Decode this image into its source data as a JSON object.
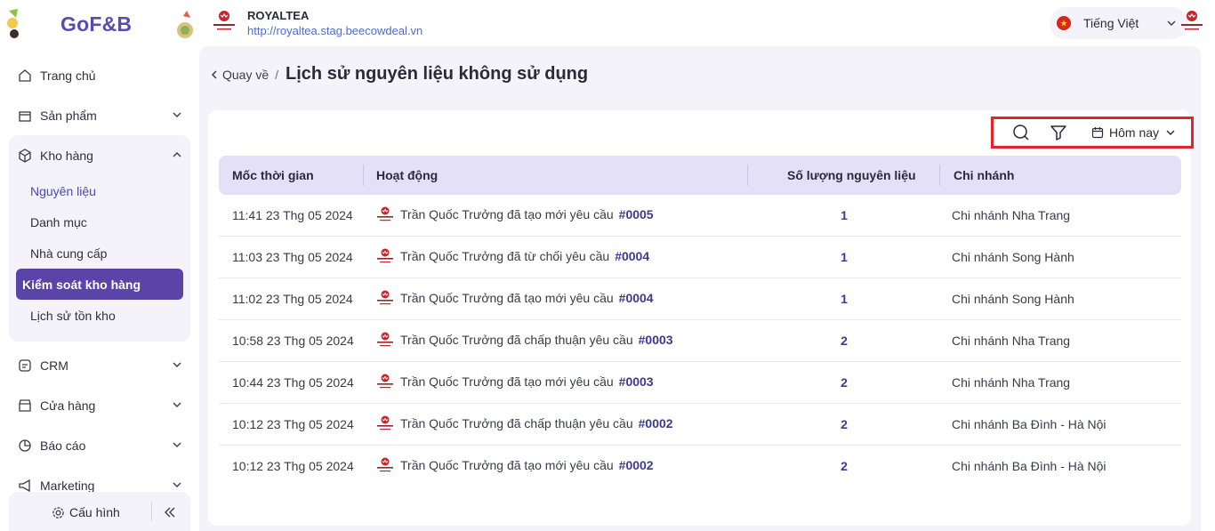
{
  "brand": {
    "name": "GoF&B"
  },
  "store": {
    "name": "ROYALTEA",
    "url": "http://royaltea.stag.beecowdeal.vn"
  },
  "language": {
    "label": "Tiếng Việt"
  },
  "sidebar": {
    "items": [
      {
        "label": "Trang chủ"
      },
      {
        "label": "Sản phẩm"
      },
      {
        "label": "Kho hàng"
      },
      {
        "label": "CRM"
      },
      {
        "label": "Cửa hàng"
      },
      {
        "label": "Báo cáo"
      },
      {
        "label": "Marketing"
      }
    ],
    "warehouse_sub": [
      {
        "label": "Nguyên liệu"
      },
      {
        "label": "Danh mục"
      },
      {
        "label": "Nhà cung cấp"
      },
      {
        "label": "Kiểm soát kho hàng"
      },
      {
        "label": "Lịch sử tồn kho"
      }
    ],
    "config_label": "Cấu hình"
  },
  "breadcrumb": {
    "back": "Quay về",
    "separator": "/",
    "title": "Lịch sử nguyên liệu không sử dụng"
  },
  "toolbar": {
    "date_filter": "Hôm nay"
  },
  "table": {
    "headers": [
      "Mốc thời gian",
      "Hoạt động",
      "Số lượng nguyên liệu",
      "Chi nhánh"
    ],
    "rows": [
      {
        "time": "11:41 23 Thg 05 2024",
        "activity": "Trần Quốc Trưởng đã tạo mới yêu cầu",
        "code": "#0005",
        "qty": "1",
        "branch": "Chi nhánh Nha Trang"
      },
      {
        "time": "11:03 23 Thg 05 2024",
        "activity": "Trần Quốc Trưởng đã từ chối yêu cầu",
        "code": "#0004",
        "qty": "1",
        "branch": "Chi nhánh Song Hành"
      },
      {
        "time": "11:02 23 Thg 05 2024",
        "activity": "Trần Quốc Trưởng đã tạo mới yêu cầu",
        "code": "#0004",
        "qty": "1",
        "branch": "Chi nhánh Song Hành"
      },
      {
        "time": "10:58 23 Thg 05 2024",
        "activity": "Trần Quốc Trưởng đã chấp thuận yêu cầu",
        "code": "#0003",
        "qty": "2",
        "branch": "Chi nhánh Nha Trang"
      },
      {
        "time": "10:44 23 Thg 05 2024",
        "activity": "Trần Quốc Trưởng đã tạo mới yêu cầu",
        "code": "#0003",
        "qty": "2",
        "branch": "Chi nhánh Nha Trang"
      },
      {
        "time": "10:12 23 Thg 05 2024",
        "activity": "Trần Quốc Trưởng đã chấp thuận yêu cầu",
        "code": "#0002",
        "qty": "2",
        "branch": "Chi nhánh Ba Đình - Hà Nội"
      },
      {
        "time": "10:12 23 Thg 05 2024",
        "activity": "Trần Quốc Trưởng đã tạo mới yêu cầu",
        "code": "#0002",
        "qty": "2",
        "branch": "Chi nhánh Ba Đình - Hà Nội"
      }
    ]
  },
  "colors": {
    "accent": "#5a44a8",
    "header_bg": "#e4e0f7",
    "page_bg": "#f4f3f9",
    "highlight_box": "#e4242a"
  }
}
